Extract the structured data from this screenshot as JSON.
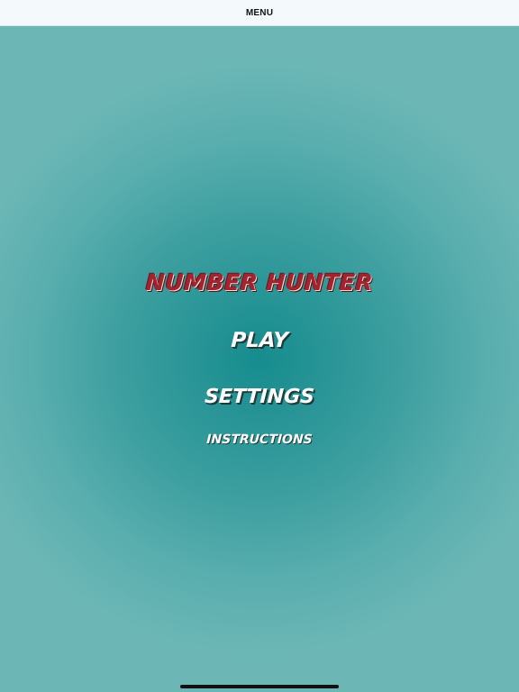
{
  "header": {
    "title": "MENU"
  },
  "game": {
    "title": "NUMBER HUNTER",
    "buttons": {
      "play": "PLAY",
      "settings": "SETTINGS",
      "instructions": "INSTRUCTIONS"
    }
  },
  "colors": {
    "background_center": "#168c8e",
    "background_edge": "#6cb7b6",
    "title_red": "#a3232e",
    "button_text": "#ffffff",
    "top_bar": "#f4fafc"
  }
}
